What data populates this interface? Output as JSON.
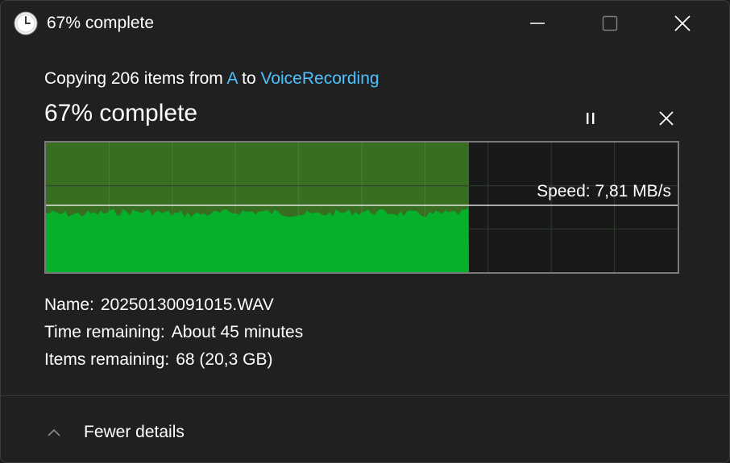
{
  "window": {
    "title": "67% complete",
    "icon": "clock-icon"
  },
  "summary": {
    "prefix": "Copying 206 items from ",
    "source": "A",
    "middle": " to ",
    "destination": "VoiceRecording"
  },
  "progress": {
    "percent_text": "67% complete",
    "fraction": 0.67
  },
  "graph": {
    "speed_text": "Speed: 7,81 MB/s"
  },
  "details": {
    "name_label": "Name:",
    "name_value": "20250130091015.WAV",
    "time_label": "Time remaining:",
    "time_value": "About 45 minutes",
    "items_label": "Items remaining:",
    "items_value": "68 (20,3 GB)"
  },
  "footer": {
    "toggle_label": "Fewer details",
    "toggle_icon": "chevron-up-icon"
  },
  "colors": {
    "accent_link": "#4cc2ff",
    "progress_dark": "#376e22",
    "throughput_green": "#06b02b"
  }
}
